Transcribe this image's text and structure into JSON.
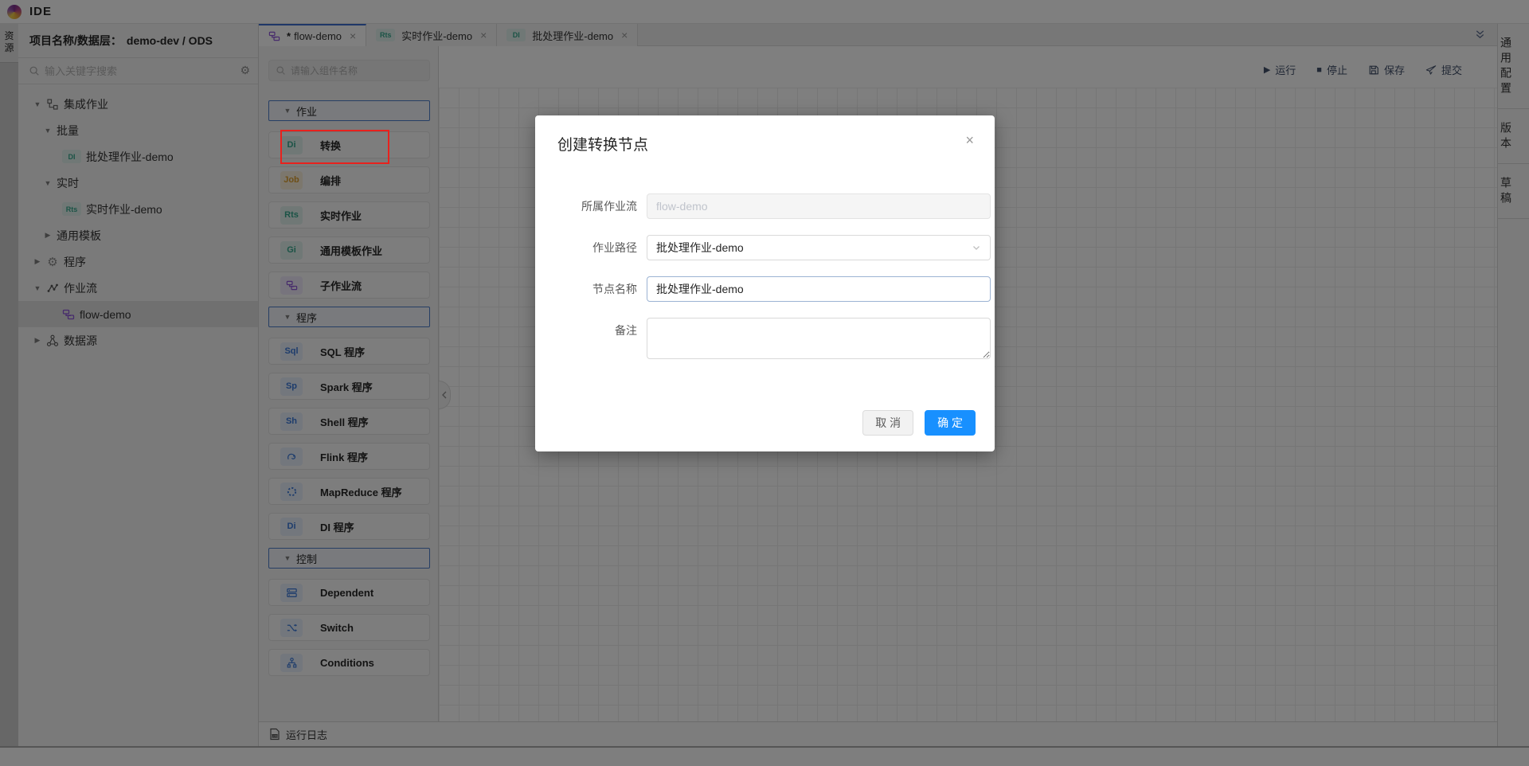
{
  "app": {
    "title": "IDE"
  },
  "left_rail": {
    "resources_tab": "资源"
  },
  "sidebar": {
    "header_label": "项目名称/数据层：",
    "header_value": "demo-dev / ODS",
    "search_placeholder": "输入关键字搜索",
    "tree": [
      {
        "label": "集成作业",
        "icon": "integration-icon",
        "state": "expanded"
      },
      {
        "label": "批量",
        "state": "expanded"
      },
      {
        "label": "批处理作业-demo",
        "badge": "DI"
      },
      {
        "label": "实时",
        "state": "expanded"
      },
      {
        "label": "实时作业-demo",
        "badge": "Rts"
      },
      {
        "label": "通用模板",
        "state": "collapsed"
      },
      {
        "label": "程序",
        "icon": "gear-icon",
        "state": "collapsed"
      },
      {
        "label": "作业流",
        "icon": "workflow-icon",
        "state": "expanded"
      },
      {
        "label": "flow-demo",
        "icon": "flow-icon",
        "selected": true
      },
      {
        "label": "数据源",
        "icon": "datasource-icon",
        "state": "collapsed"
      }
    ]
  },
  "tabs": [
    {
      "dirty": "*",
      "label": "flow-demo",
      "icon": "flow-icon",
      "close": "×",
      "active": true
    },
    {
      "badge": "Rts",
      "label": "实时作业-demo",
      "close": "×"
    },
    {
      "badge": "DI",
      "label": "批处理作业-demo",
      "close": "×"
    }
  ],
  "toolbar": {
    "run": "运行",
    "stop": "停止",
    "save": "保存",
    "submit": "提交"
  },
  "palette": {
    "search_placeholder": "请输入组件名称",
    "sections": [
      {
        "title": "作业",
        "items": [
          {
            "badge": "Di",
            "label": "转换",
            "color": "teal",
            "annotated": true
          },
          {
            "badge": "Job",
            "label": "编排",
            "color": "orange"
          },
          {
            "badge": "Rts",
            "label": "实时作业",
            "color": "teal"
          },
          {
            "badge": "Gi",
            "label": "通用模板作业",
            "color": "teal"
          },
          {
            "icon": "subflow-icon",
            "label": "子作业流",
            "color": "purple"
          }
        ]
      },
      {
        "title": "程序",
        "items": [
          {
            "badge": "Sql",
            "label": "SQL 程序",
            "color": "blue"
          },
          {
            "badge": "Sp",
            "label": "Spark 程序",
            "color": "blue"
          },
          {
            "badge": "Sh",
            "label": "Shell 程序",
            "color": "blue"
          },
          {
            "icon": "flink-icon",
            "label": "Flink 程序",
            "color": "blue"
          },
          {
            "icon": "mapreduce-icon",
            "label": "MapReduce 程序",
            "color": "blue"
          },
          {
            "badge": "Di",
            "label": "DI 程序",
            "color": "blue"
          }
        ]
      },
      {
        "title": "控制",
        "items": [
          {
            "icon": "dependent-icon",
            "label": "Dependent",
            "color": "blue"
          },
          {
            "icon": "switch-icon",
            "label": "Switch",
            "color": "blue"
          },
          {
            "icon": "conditions-icon",
            "label": "Conditions",
            "color": "blue"
          }
        ]
      }
    ]
  },
  "right_rail": {
    "items": [
      "通用配置",
      "版本",
      "草稿"
    ]
  },
  "log_bar": {
    "label": "运行日志"
  },
  "modal": {
    "title": "创建转换节点",
    "close": "×",
    "fields": [
      {
        "label": "所属作业流",
        "value": "flow-demo",
        "type": "disabled"
      },
      {
        "label": "作业路径",
        "value": "批处理作业-demo",
        "type": "select"
      },
      {
        "label": "节点名称",
        "value": "批处理作业-demo",
        "type": "input"
      },
      {
        "label": "备注",
        "value": "",
        "type": "textarea"
      }
    ],
    "cancel": "取 消",
    "ok": "确 定"
  },
  "colors": {
    "accent": "#3e6fd0",
    "primary": "#1890ff",
    "annotation": "#e8211d",
    "teal": "#36a68d",
    "orange": "#dd9f2e",
    "purple": "#8f56d8",
    "blue": "#3b79d8"
  }
}
